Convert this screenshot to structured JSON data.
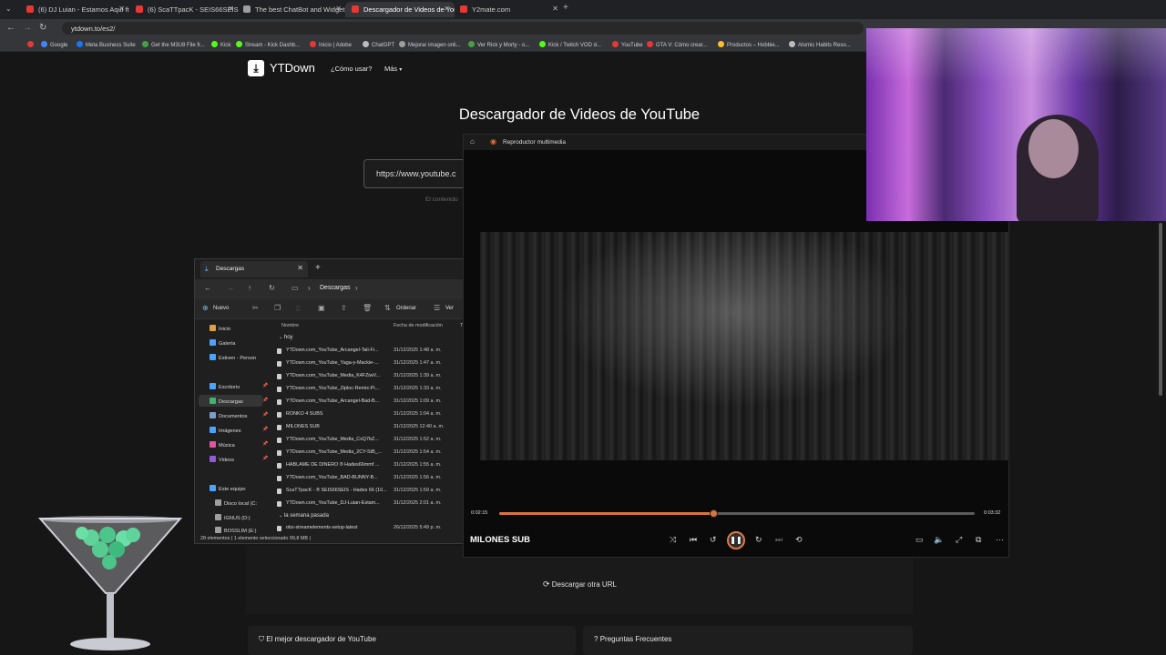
{
  "browser": {
    "tabs": [
      {
        "label": "(6) DJ Luian - Estamos Aqui ft.",
        "color": "#e53935",
        "active": false
      },
      {
        "label": "(6) ScaTTpacK - SEIS66SEIS",
        "color": "#e53935",
        "active": false
      },
      {
        "label": "The best ChatBot and Widgets",
        "color": "#9e9e9e",
        "active": false
      },
      {
        "label": "Descargador de Videos de You",
        "color": "#e53935",
        "active": true
      },
      {
        "label": "Y2mate.com",
        "color": "#e53935",
        "active": false
      }
    ],
    "url": "ytdown.to/es2/",
    "bookmarks": [
      {
        "label": "",
        "color": "#e53935"
      },
      {
        "label": "Google",
        "color": "#4285f4"
      },
      {
        "label": "Meta Business Suite",
        "color": "#1877f2"
      },
      {
        "label": "Get the M3U8 File fr...",
        "color": "#43a047"
      },
      {
        "label": "Kick",
        "color": "#53fc18"
      },
      {
        "label": "Stream - Kick Dashb...",
        "color": "#53fc18"
      },
      {
        "label": "Inicio | Adobe",
        "color": "#e53935"
      },
      {
        "label": "ChatGPT",
        "color": "#bdbdbd"
      },
      {
        "label": "Mejorar imagen onli...",
        "color": "#9e9e9e"
      },
      {
        "label": "Ver Rick y Morty - o...",
        "color": "#43a047"
      },
      {
        "label": "Kick / Twitch VOD d...",
        "color": "#53fc18"
      },
      {
        "label": "YouTube",
        "color": "#e53935"
      },
      {
        "label": "GTA V: Cómo crear...",
        "color": "#e53935"
      },
      {
        "label": "Productos – Hobbie...",
        "color": "#fbc02d"
      },
      {
        "label": "Atomic Habits Reso...",
        "color": "#bdbdbd"
      }
    ]
  },
  "site": {
    "logo": "YTDown",
    "nav": {
      "how": "¿Cómo usar?",
      "more": "Más"
    },
    "title": "Descargador de Videos de YouTube",
    "url_value": "https://www.youtube.c",
    "content_note": "El contenido",
    "download_other": "Descargar otra URL",
    "cards": [
      "El mejor descargador de YouTube",
      "Preguntas Frecuentes"
    ]
  },
  "explorer": {
    "tab_title": "Descargas",
    "breadcrumb": "Descargas",
    "toolbar": {
      "new": "Nuevo",
      "sort": "Ordenar",
      "view": "Ver"
    },
    "sidebar": [
      {
        "label": "Inicio",
        "color": "#e0a040",
        "pin": false
      },
      {
        "label": "Galería",
        "color": "#4aa3ff",
        "pin": false
      },
      {
        "label": "Estiven - Person",
        "color": "#4aa3ff",
        "pin": false
      },
      {
        "label": "Escritorio",
        "color": "#4aa3ff",
        "pin": true
      },
      {
        "label": "Descargas",
        "color": "#3fb36f",
        "pin": true
      },
      {
        "label": "Documentos",
        "color": "#7d9cc9",
        "pin": true
      },
      {
        "label": "Imágenes",
        "color": "#4aa3ff",
        "pin": true
      },
      {
        "label": "Música",
        "color": "#e0559c",
        "pin": true
      },
      {
        "label": "Videos",
        "color": "#8f5bd6",
        "pin": true
      },
      {
        "label": "Este equipo",
        "color": "#4aa3ff",
        "pin": false
      },
      {
        "label": "Disco local (C:",
        "color": "#9e9e9e",
        "pin": false
      },
      {
        "label": "IGNUS (D:)",
        "color": "#9e9e9e",
        "pin": false
      },
      {
        "label": "BOSSLIM (E:)",
        "color": "#9e9e9e",
        "pin": false
      }
    ],
    "columns": {
      "name": "Nombre",
      "date": "Fecha de modificación",
      "type": "T"
    },
    "groups": {
      "today": "hoy",
      "lastweek": "la semana pasada"
    },
    "files": [
      {
        "name": "YTDown.com_YouTube_Arcangel-Tali-Fi...",
        "date": "31/12/2025 1:48 a. m."
      },
      {
        "name": "YTDown.com_YouTube_Yaga-y-Mackie-...",
        "date": "31/12/2025 1:47 a. m."
      },
      {
        "name": "YTDown.com_YouTube_Media_K4FZiwV...",
        "date": "31/12/2025 1:39 a. m."
      },
      {
        "name": "YTDown.com_YouTube_Ziploc-Remix-Pi...",
        "date": "31/12/2025 1:33 a. m."
      },
      {
        "name": "YTDown.com_YouTube_Arcangel-Bad-B...",
        "date": "31/12/2025 1:09 a. m."
      },
      {
        "name": "RONKO 4 SUBS",
        "date": "31/12/2025 1:04 a. m."
      },
      {
        "name": "MILONES SUB",
        "date": "31/12/2025 12:40 a. m."
      },
      {
        "name": "YTDown.com_YouTube_Media_CxQ7bZ...",
        "date": "31/12/2025 1:52 a. m."
      },
      {
        "name": "YTDown.com_YouTube_Media_2CY-StB_...",
        "date": "31/12/2025 1:54 a. m."
      },
      {
        "name": "HÁBLAME DE DINERO ® Hades66mmf ...",
        "date": "31/12/2025 1:55 a. m."
      },
      {
        "name": "YTDown.com_YouTube_BAD-BUNNY-B...",
        "date": "31/12/2025 1:56 a. m."
      },
      {
        "name": "ScaTTpacK - ® SEIS66SEIS - Hades 66 (10...",
        "date": "31/12/2025 1:59 a. m."
      },
      {
        "name": "YTDown.com_YouTube_DJ-Luian-Estam...",
        "date": "31/12/2025 2:01 a. m."
      }
    ],
    "lastweek_file": {
      "name": "obs-streamelements-setup-latest",
      "date": "26/12/2025 5:49 p. m."
    },
    "status": "28 elementos  |  1 elemento seleccionado  99,8 MB  |"
  },
  "player": {
    "app_title": "Reproductor multimedia",
    "track": "MILONES SUB",
    "time_current": "0:02:15",
    "time_total": "0:03:32",
    "progress": 0.45,
    "accent": "#d9753b"
  }
}
